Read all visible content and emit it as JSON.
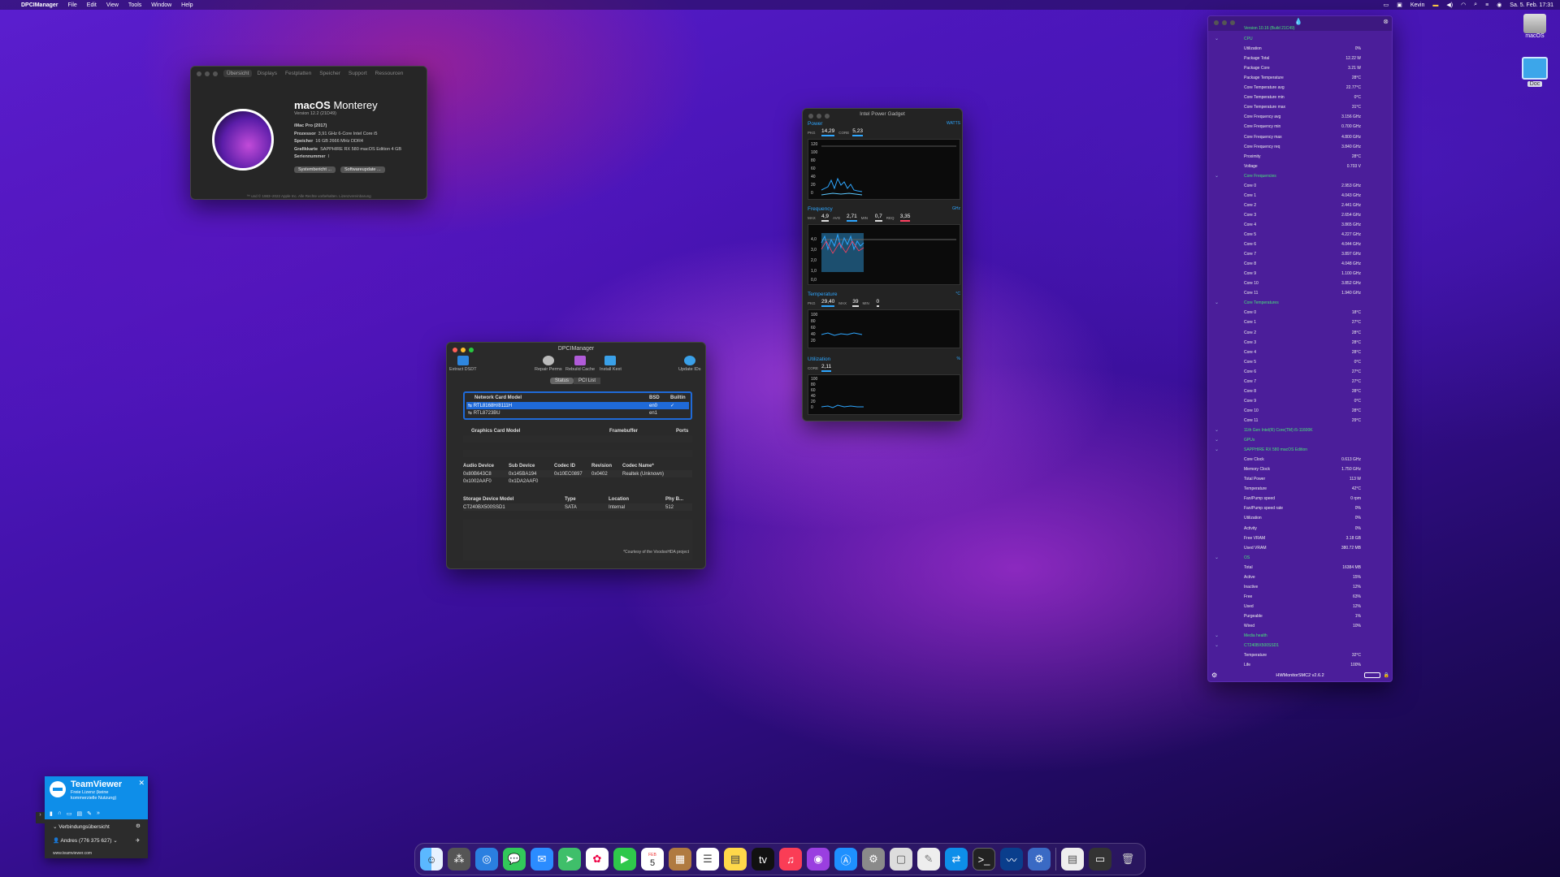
{
  "menubar": {
    "app": "DPCIManager",
    "menus": [
      "File",
      "Edit",
      "View",
      "Tools",
      "Window",
      "Help"
    ],
    "user": "Kevin",
    "clock": "Sa. 5. Feb. 17:31"
  },
  "about": {
    "tabs": [
      "Übersicht",
      "Displays",
      "Festplatten",
      "Speicher",
      "Support",
      "Ressourcen"
    ],
    "os": "macOS",
    "os_name": "Monterey",
    "version": "Version 12.2 (21D49)",
    "specs": [
      {
        "k": "iMac Pro (2017)",
        "v": ""
      },
      {
        "k": "Prozessor",
        "v": "3,91 GHz 6-Core Intel Core i5"
      },
      {
        "k": "Speicher",
        "v": "16 GB 2666 MHz DDR4"
      },
      {
        "k": "Grafikkarte",
        "v": "SAPPHIRE RX 580 macOS Edition 4 GB"
      },
      {
        "k": "Seriennummer",
        "v": "l"
      }
    ],
    "btn1": "Systembericht ...",
    "btn2": "Softwareupdate ...",
    "footer": "™ und © 1983–2022 Apple Inc. Alle Rechte vorbehalten. Lizenzvereinbarung"
  },
  "dpci": {
    "title": "DPCIManager",
    "toolbar": [
      "Extract DSDT",
      "Repair Perms",
      "Rebuild Cache",
      "Install Kext",
      "Update IDs"
    ],
    "tabs": [
      "Status",
      "PCI List"
    ],
    "network": {
      "headers": [
        "Network Card Model",
        "BSD",
        "Builtin"
      ],
      "rows": [
        [
          "RTL8168H/8111H",
          "en0",
          "✓"
        ],
        [
          "RTL8723BU",
          "en1",
          ""
        ]
      ]
    },
    "graphics": {
      "headers": [
        "Graphics Card Model",
        "Framebuffer",
        "Ports"
      ]
    },
    "audio": {
      "headers": [
        "Audio Device",
        "Sub Device",
        "Codec ID",
        "Revision",
        "Codec Name*"
      ],
      "rows": [
        [
          "0x80B643C8",
          "0x145BA194",
          "0x10EC0897",
          "0x0402",
          "Realtek (Unknown)"
        ],
        [
          "0x1002AAF0",
          "0x1DA2AAF0",
          "",
          "",
          ""
        ]
      ]
    },
    "storage": {
      "headers": [
        "Storage Device Model",
        "Type",
        "Location",
        "Phy B..."
      ],
      "rows": [
        [
          "CT240BX500SSD1",
          "SATA",
          "Internal",
          "512"
        ]
      ]
    },
    "credit": "*Courtesy of the VoodooHDA project"
  },
  "ipg": {
    "title": "Intel Power Gadget",
    "power": {
      "label": "Power",
      "unit": "WATTS",
      "pkg": "14,29",
      "core": "5,23",
      "yticks": [
        "120",
        "100",
        "80",
        "60",
        "40",
        "20",
        "0"
      ]
    },
    "freq": {
      "label": "Frequency",
      "unit": "GHz",
      "max": "4,9",
      "avg": "2,71",
      "min": "0,7",
      "req": "3,35",
      "yticks": [
        "4,0",
        "3,0",
        "2,0",
        "1,0",
        "0,0"
      ]
    },
    "temp": {
      "label": "Temperature",
      "unit": "°C",
      "pkg": "29,40",
      "max": "39",
      "min": "0",
      "yticks": [
        "100",
        "80",
        "60",
        "40",
        "20"
      ]
    },
    "util": {
      "label": "Utilization",
      "unit": "%",
      "core": "2,11",
      "yticks": [
        "100",
        "80",
        "60",
        "40",
        "20",
        "0"
      ]
    }
  },
  "hwm": {
    "version": "Version 10.16 (Build 21C49)",
    "footer": "HWMonitorSMC2 v2.6.2",
    "rows": [
      {
        "t": "h",
        "k": "CPU"
      },
      {
        "k": "Utilization",
        "v": "0%"
      },
      {
        "k": "Package Total",
        "v": "12.22 W"
      },
      {
        "k": "Package Core",
        "v": "3.21 W"
      },
      {
        "k": "Package Temperature",
        "v": "28°C"
      },
      {
        "k": "Core Temperature avg",
        "v": "22.77°C"
      },
      {
        "k": "Core Temperature min",
        "v": "0°C"
      },
      {
        "k": "Core Temperature max",
        "v": "31°C"
      },
      {
        "k": "Core Frequency avg",
        "v": "3.156 GHz"
      },
      {
        "k": "Core Frequency min",
        "v": "0.700 GHz"
      },
      {
        "k": "Core Frequency max",
        "v": "4.800 GHz"
      },
      {
        "k": "Core Frequency req",
        "v": "3.840 GHz"
      },
      {
        "k": "Proximity",
        "v": "28°C"
      },
      {
        "k": "Voltage",
        "v": "0.703 V"
      },
      {
        "t": "h",
        "k": "Core Frequencies"
      },
      {
        "k": "Core 0",
        "v": "2.953 GHz"
      },
      {
        "k": "Core 1",
        "v": "4.043 GHz"
      },
      {
        "k": "Core 2",
        "v": "2.441 GHz"
      },
      {
        "k": "Core 3",
        "v": "2.654 GHz"
      },
      {
        "k": "Core 4",
        "v": "3.865 GHz"
      },
      {
        "k": "Core 5",
        "v": "4.227 GHz"
      },
      {
        "k": "Core 6",
        "v": "4.044 GHz"
      },
      {
        "k": "Core 7",
        "v": "3.897 GHz"
      },
      {
        "k": "Core 8",
        "v": "4.048 GHz"
      },
      {
        "k": "Core 9",
        "v": "1.100 GHz"
      },
      {
        "k": "Core 10",
        "v": "3.852 GHz"
      },
      {
        "k": "Core 11",
        "v": "1.940 GHz"
      },
      {
        "t": "h",
        "k": "Core Temperatures"
      },
      {
        "k": "Core 0",
        "v": "18°C"
      },
      {
        "k": "Core 1",
        "v": "27°C"
      },
      {
        "k": "Core 2",
        "v": "28°C"
      },
      {
        "k": "Core 3",
        "v": "28°C"
      },
      {
        "k": "Core 4",
        "v": "28°C"
      },
      {
        "k": "Core 5",
        "v": "0°C"
      },
      {
        "k": "Core 6",
        "v": "27°C"
      },
      {
        "k": "Core 7",
        "v": "27°C"
      },
      {
        "k": "Core 8",
        "v": "28°C"
      },
      {
        "k": "Core 9",
        "v": "0°C"
      },
      {
        "k": "Core 10",
        "v": "28°C"
      },
      {
        "k": "Core 11",
        "v": "29°C"
      },
      {
        "t": "h",
        "k": "11th Gen Intel(R) Core(TM) i5-11600K"
      },
      {
        "t": "h",
        "k": "GPUs"
      },
      {
        "t": "h",
        "k": "SAPPHIRE RX 580 macOS Edition"
      },
      {
        "k": "Core Clock",
        "v": "0.613 GHz"
      },
      {
        "k": "Memory Clock",
        "v": "1.750 GHz"
      },
      {
        "k": "Total Power",
        "v": "113 W"
      },
      {
        "k": "Temperature",
        "v": "42°C"
      },
      {
        "k": "Fan/Pump speed",
        "v": "0 rpm"
      },
      {
        "k": "Fan/Pump speed rate",
        "v": "0%"
      },
      {
        "k": "Utilization",
        "v": "0%"
      },
      {
        "k": "Activity",
        "v": "0%"
      },
      {
        "k": "Free VRAM",
        "v": "3.18 GB"
      },
      {
        "k": "Used VRAM",
        "v": "380.72 MB"
      },
      {
        "t": "h",
        "k": "OS"
      },
      {
        "k": "Total",
        "v": "16384 MB"
      },
      {
        "k": "Active",
        "v": "15%"
      },
      {
        "k": "Inactive",
        "v": "12%"
      },
      {
        "k": "Free",
        "v": "63%"
      },
      {
        "k": "Used",
        "v": "12%"
      },
      {
        "k": "Purgeable",
        "v": "1%"
      },
      {
        "k": "Wired",
        "v": "10%"
      },
      {
        "t": "h",
        "k": "Media health"
      },
      {
        "t": "h",
        "k": "CT240BX500SSD1"
      },
      {
        "k": "Temperature",
        "v": "32°C"
      },
      {
        "k": "Life",
        "v": "100%"
      }
    ]
  },
  "teamviewer": {
    "name": "TeamViewer",
    "sub1": "Freie Lizenz (keine",
    "sub2": "kommerzielle Nutzung)",
    "section": "Verbindungsübersicht",
    "user": "Andres (776 375 627)",
    "url": "www.teamviewer.com"
  },
  "desktop": {
    "disk_label": "macOS",
    "folder_label": "Doc"
  },
  "dock": {
    "calendar_day": "5",
    "calendar_month": "FEB"
  }
}
